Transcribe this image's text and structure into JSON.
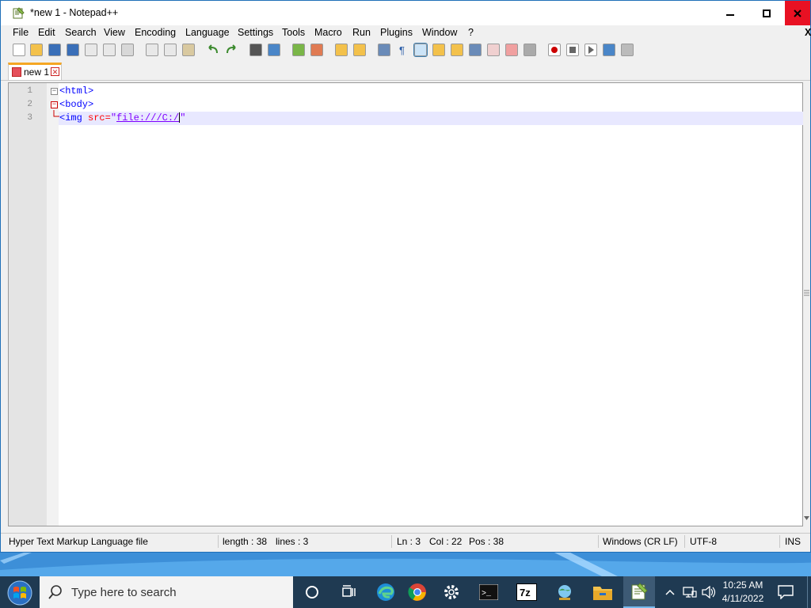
{
  "window": {
    "title": "*new 1 - Notepad++",
    "controls": [
      "minimize",
      "maximize",
      "close"
    ]
  },
  "menu": [
    "File",
    "Edit",
    "Search",
    "View",
    "Encoding",
    "Language",
    "Settings",
    "Tools",
    "Macro",
    "Run",
    "Plugins",
    "Window",
    "?"
  ],
  "menu_close_x": "X",
  "toolbar_icons": [
    "new-file-icon",
    "open-file-icon",
    "save-icon",
    "save-all-icon",
    "close-icon",
    "close-all-icon",
    "print-icon",
    "cut-icon",
    "copy-icon",
    "paste-icon",
    "undo-icon",
    "redo-icon",
    "find-icon",
    "replace-icon",
    "zoom-in-icon",
    "zoom-out-icon",
    "sync-vertical-icon",
    "sync-horizontal-icon",
    "word-wrap-icon",
    "show-all-chars-icon",
    "indent-guide-icon",
    "user-defined-lang-icon",
    "doc-map-icon",
    "doc-list-icon",
    "function-list-icon",
    "folder-workspace-icon",
    "monitoring-icon",
    "record-macro-icon",
    "stop-macro-icon",
    "play-macro-icon",
    "run-macro-multiple-icon",
    "save-macro-icon"
  ],
  "tab": {
    "label": "new 1"
  },
  "editor": {
    "lines": [
      {
        "num": "1",
        "tag_open": "<html>"
      },
      {
        "num": "2",
        "tag_open": "<body>"
      },
      {
        "num": "3",
        "tag": "<img",
        "attr": " src=",
        "quote_open": "\"",
        "value": "file:///C:/",
        "quote_close": "\""
      }
    ]
  },
  "status": {
    "file_type": "Hyper Text Markup Language file",
    "length": "length : 38",
    "lines": "lines : 3",
    "ln": "Ln : 3",
    "col": "Col : 22",
    "pos": "Pos : 38",
    "eol": "Windows (CR LF)",
    "encoding": "UTF-8",
    "mode": "INS"
  },
  "taskbar": {
    "search_placeholder": "Type here to search",
    "time": "10:25 AM",
    "date": "4/11/2022",
    "apps": [
      "cortana-icon",
      "task-view-icon",
      "edge-icon",
      "chrome-icon",
      "settings-icon",
      "terminal-icon",
      "7zip-icon",
      "network-globe-icon",
      "file-explorer-icon",
      "notepadpp-icon"
    ],
    "terminal_glyph": ">_",
    "sevenzip_label": "7z"
  },
  "colors": {
    "tag": "#0000ff",
    "attr": "#ff0000",
    "string": "#8000ff",
    "current_line": "#e8e8ff",
    "tab_accent": "#f5a623",
    "taskbar": "#1f3a52"
  }
}
